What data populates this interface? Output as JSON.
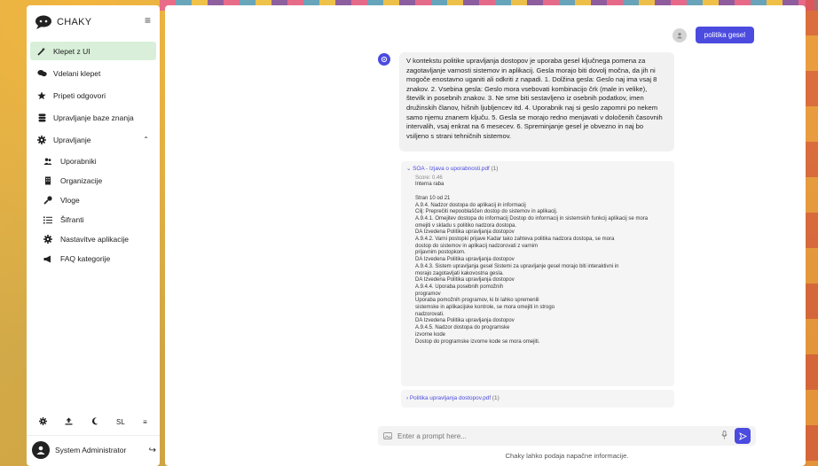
{
  "sidebar": {
    "brand": "CHAKY",
    "items": [
      {
        "label": "Klepet z UI",
        "icon": "magic-wand-icon",
        "active": true
      },
      {
        "label": "Vdelani klepet",
        "icon": "chat-bubbles-icon"
      },
      {
        "label": "Pripeti odgovori",
        "icon": "star-icon"
      },
      {
        "label": "Upravljanje baze znanja",
        "icon": "database-icon"
      },
      {
        "label": "Upravljanje",
        "icon": "gear-icon"
      }
    ],
    "subitems": [
      {
        "label": "Uporabniki",
        "icon": "users-icon"
      },
      {
        "label": "Organizacije",
        "icon": "building-icon"
      },
      {
        "label": "Vloge",
        "icon": "key-icon"
      },
      {
        "label": "Šifranti",
        "icon": "list-icon"
      },
      {
        "label": "Nastavitve aplikacije",
        "icon": "gear-icon"
      },
      {
        "label": "FAQ kategorije",
        "icon": "megaphone-icon"
      }
    ],
    "footer_lang": "SL",
    "user_name": "System Administrator"
  },
  "chat": {
    "user_message": "politika gesel",
    "bot_message": "V kontekstu politike upravljanja dostopov je uporaba gesel ključnega pomena za zagotavljanje varnosti sistemov in aplikacij. Gesla morajo biti dovolj močna, da jih ni mogoče enostavno uganiti ali odkriti z napadi. 1. Dolžina gesla: Geslo naj ima vsaj 8 znakov. 2. Vsebina gesla: Geslo mora vsebovati kombinacijo črk (male in velike), številk in posebnih znakov. 3. Ne sme biti sestavljeno iz osebnih podatkov, imen družinskih članov, hišnih ljubljencev itd. 4. Uporabnik naj si geslo zapomni po nekem samo njemu znanem ključu. 5. Gesla se morajo redno menjavati v določenih časovnih intervalih, vsaj enkrat na 6 mesecev. 6. Spreminjanje gesel je obvezno in naj bo vsiljeno s strani tehničnih sistemov.",
    "source1": {
      "title": "SOA - Izjava o uporabnosti.pdf",
      "count": "(1)",
      "score": "Score: 0.46",
      "body": "Interna raba\n\nStran 10 od 21\nA.9.4. Nadzor dostopa do aplikacij in informacij\nCilj: Preprečiti nepooblaščen dostop do sistemov in aplikacij.\nA.9.4.1. Omejitev dostopa do informacij Dostop do informacij in sistemskih funkcij aplikacij se mora\nomejiti v skladu s politiko nadzora dostopa.\nDA Izvedena Politika upravljanja dostopov\nA.9.4.2. Varni postopki prijave Kadar tako zahteva politika nadzora dostopa, se mora\ndostop do sistemov in aplikacij nadzorovati z varnim\nprijavnim postopkom.\nDA Izvedena Politika upravljanja dostopov\nA.9.4.3. Sistem upravljanja gesel Sistemi za upravljanje gesel morajo biti interaktivni in\nmorajo zagotavljati kakovostna gesla.\nDA Izvedena Politika upravljanja dostopov\nA.9.4.4. Uporaba posebnih pomožnih\nprogramov\nUporaba pomožnih programov, ki bi lahko spremenili\nsistemske in aplikacijske kontrole, se mora omejiti in strogo\nnadzorovati.\nDA Izvedena Politika upravljanja dostopov\nA.9.4.5. Nadzor dostopa do programske\nizvorne kode\nDostop do programske izvorne kode se mora omejiti."
    },
    "source2": {
      "title": "Politika upravljanja dostopov.pdf",
      "count": "(1)"
    },
    "prompt_placeholder": "Enter a prompt here...",
    "disclaimer": "Chaky lahko podaja napačne informacije."
  }
}
